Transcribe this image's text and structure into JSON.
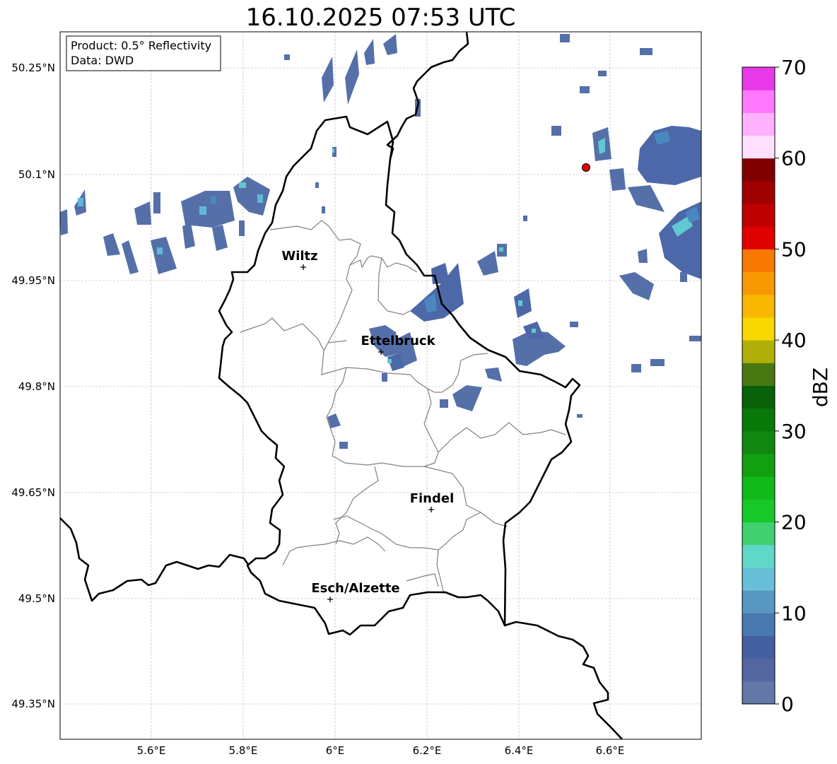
{
  "title": "16.10.2025 07:53 UTC",
  "info_box": {
    "product_line": "Product: 0.5° Reflectivity",
    "data_line": "Data: DWD"
  },
  "lon_ticks": [
    "5.6°E",
    "5.8°E",
    "6°E",
    "6.2°E",
    "6.4°E",
    "6.6°E"
  ],
  "lat_ticks": [
    "50.25°N",
    "50.1°N",
    "49.95°N",
    "49.8°N",
    "49.65°N",
    "49.5°N",
    "49.35°N"
  ],
  "cities": [
    {
      "name": "Wiltz"
    },
    {
      "name": "Ettelbruck"
    },
    {
      "name": "Findel"
    },
    {
      "name": "Esch/Alzette"
    }
  ],
  "colorbar": {
    "label": "dBZ",
    "tick_labels": [
      "0",
      "10",
      "20",
      "30",
      "40",
      "50",
      "60",
      "70"
    ],
    "colors": [
      "#6478a8",
      "#5466a0",
      "#4560a0",
      "#4a78b0",
      "#5898c0",
      "#68c0d8",
      "#60d8c8",
      "#40d070",
      "#18c828",
      "#10b818",
      "#10a010",
      "#108810",
      "#087808",
      "#086008",
      "#487810",
      "#b0b008",
      "#f8d800",
      "#f8b800",
      "#f89800",
      "#f87800",
      "#e00000",
      "#c00000",
      "#a00000",
      "#800000",
      "#ffe0ff",
      "#ffb0ff",
      "#ff78ff",
      "#e838e8"
    ]
  },
  "colors": {
    "radar_main": "#5570a8",
    "radar_light": "#4a88c0",
    "radar_cyan": "#60c8d0",
    "marker": "#e00000"
  }
}
